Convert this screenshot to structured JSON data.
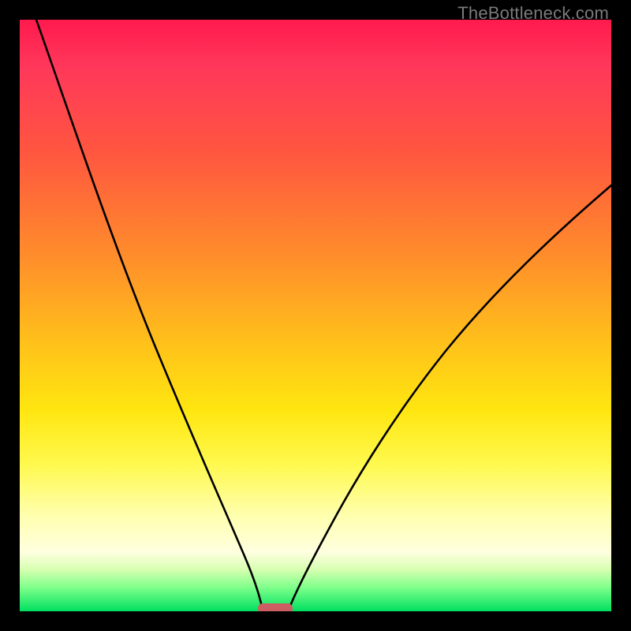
{
  "watermark": "TheBottleneck.com",
  "chart_data": {
    "type": "line",
    "title": "",
    "xlabel": "",
    "ylabel": "",
    "xlim": [
      0,
      1
    ],
    "ylim": [
      0,
      1
    ],
    "note": "Axes are unlabeled in the image; values are normalized estimates read from pixel positions (origin bottom-left).",
    "series": [
      {
        "name": "left-curve",
        "x": [
          0.028,
          0.06,
          0.1,
          0.14,
          0.18,
          0.22,
          0.26,
          0.3,
          0.33,
          0.36,
          0.38,
          0.395,
          0.405,
          0.41
        ],
        "y": [
          1.0,
          0.905,
          0.79,
          0.675,
          0.56,
          0.45,
          0.34,
          0.235,
          0.165,
          0.1,
          0.055,
          0.025,
          0.008,
          0.0
        ]
      },
      {
        "name": "right-curve",
        "x": [
          0.455,
          0.47,
          0.495,
          0.53,
          0.575,
          0.625,
          0.68,
          0.74,
          0.8,
          0.86,
          0.92,
          0.97,
          1.0
        ],
        "y": [
          0.0,
          0.015,
          0.05,
          0.105,
          0.175,
          0.255,
          0.34,
          0.425,
          0.505,
          0.575,
          0.64,
          0.69,
          0.72
        ]
      }
    ],
    "marker": {
      "name": "bottom-pill",
      "x_range": [
        0.405,
        0.46
      ],
      "y": 0.0
    },
    "background_gradient": [
      "#ff1a4d",
      "#ff8d2b",
      "#ffe610",
      "#ffffe0",
      "#00e060"
    ]
  }
}
